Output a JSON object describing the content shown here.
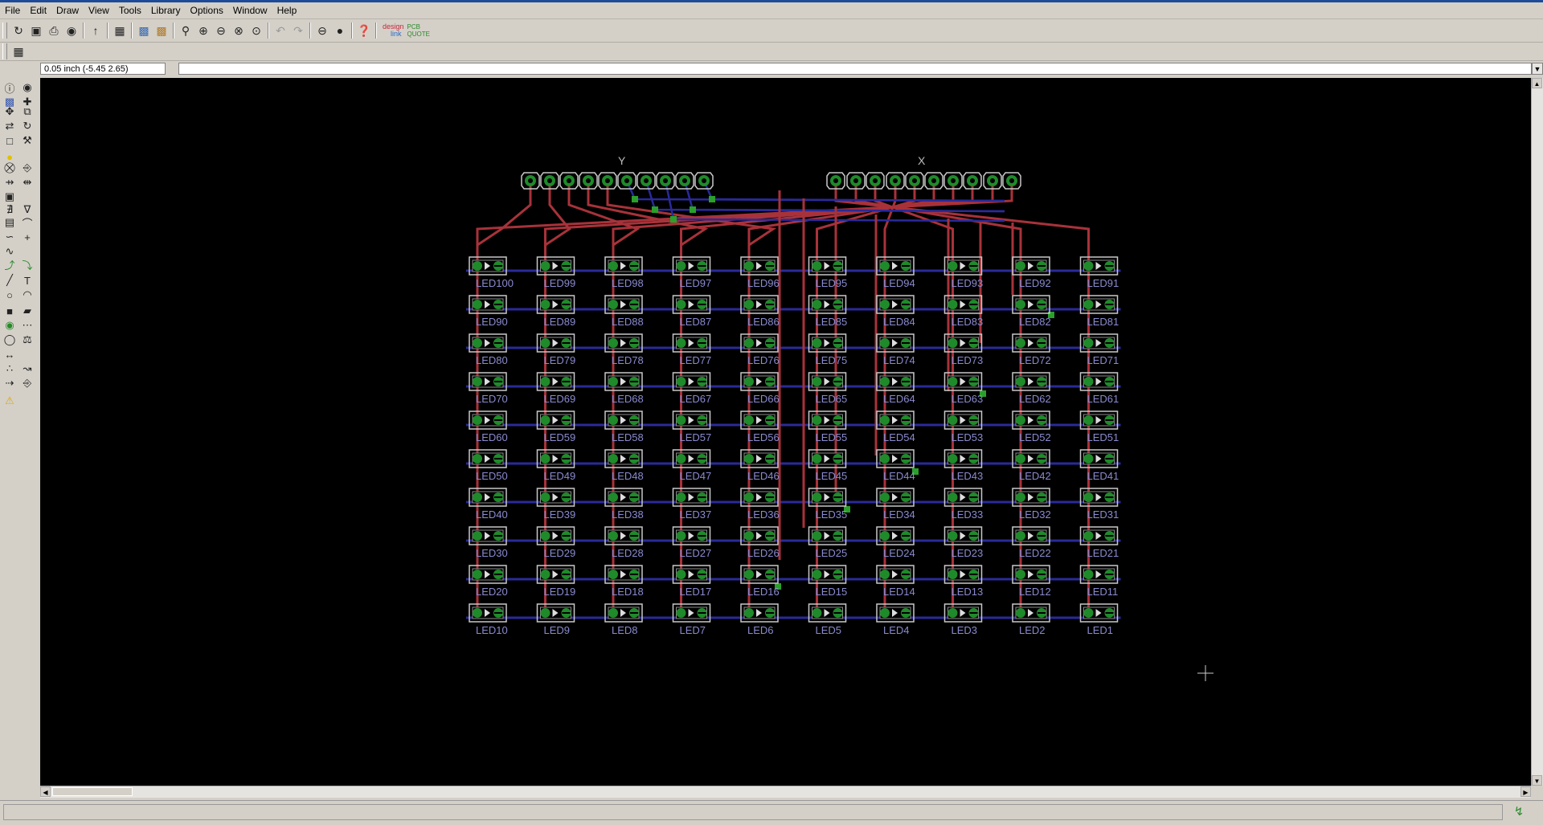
{
  "menus": [
    "File",
    "Edit",
    "Draw",
    "View",
    "Tools",
    "Library",
    "Options",
    "Window",
    "Help"
  ],
  "toolbar": {
    "buttons": [
      "open-icon",
      "save-icon",
      "print-icon",
      "cam-icon",
      "script-icon",
      "ulp-icon",
      "layer-icon",
      "window-icon",
      "zoom-fit-icon",
      "zoom-in-icon",
      "zoom-out-icon",
      "zoom-redraw-icon",
      "zoom-select-icon",
      "undo-icon",
      "redo-icon",
      "stop-icon",
      "go-icon",
      "help-icon"
    ],
    "logo_text_1": "design",
    "logo_text_2": "link",
    "logo_text_3": "PCB QUOTE"
  },
  "grid_icon": "grid-icon",
  "coordinate": "0.05 inch (-5.45 2.65)",
  "command_value": "",
  "connector_labels": {
    "y": "Y",
    "x": "X"
  },
  "leds": {
    "rows": [
      [
        "LED100",
        "LED99",
        "LED98",
        "LED97",
        "LED96",
        "LED95",
        "LED94",
        "LED93",
        "LED92",
        "LED91"
      ],
      [
        "LED90",
        "LED89",
        "LED88",
        "LED87",
        "LED86",
        "LED85",
        "LED84",
        "LED83",
        "LED82",
        "LED81"
      ],
      [
        "LED80",
        "LED79",
        "LED78",
        "LED77",
        "LED76",
        "LED75",
        "LED74",
        "LED73",
        "LED72",
        "LED71"
      ],
      [
        "LED70",
        "LED69",
        "LED68",
        "LED67",
        "LED66",
        "LED65",
        "LED64",
        "LED63",
        "LED62",
        "LED61"
      ],
      [
        "LED60",
        "LED59",
        "LED58",
        "LED57",
        "LED56",
        "LED55",
        "LED54",
        "LED53",
        "LED52",
        "LED51"
      ],
      [
        "LED50",
        "LED49",
        "LED48",
        "LED47",
        "LED46",
        "LED45",
        "LED44",
        "LED43",
        "LED42",
        "LED41"
      ],
      [
        "LED40",
        "LED39",
        "LED38",
        "LED37",
        "LED36",
        "LED35",
        "LED34",
        "LED33",
        "LED32",
        "LED31"
      ],
      [
        "LED30",
        "LED29",
        "LED28",
        "LED27",
        "LED26",
        "LED25",
        "LED24",
        "LED23",
        "LED22",
        "LED21"
      ],
      [
        "LED20",
        "LED19",
        "LED18",
        "LED17",
        "LED16",
        "LED15",
        "LED14",
        "LED13",
        "LED12",
        "LED11"
      ],
      [
        "LED10",
        "LED9",
        "LED8",
        "LED7",
        "LED6",
        "LED5",
        "LED4",
        "LED3",
        "LED2",
        "LED1"
      ]
    ]
  },
  "colors": {
    "background": "#000000",
    "top_trace": "#a8323a",
    "bottom_trace": "#2a2a9a",
    "pad": "#1f8a2a",
    "outline": "#c8c8c8",
    "label": "#8a8ad0",
    "via": "#2aa02a"
  }
}
